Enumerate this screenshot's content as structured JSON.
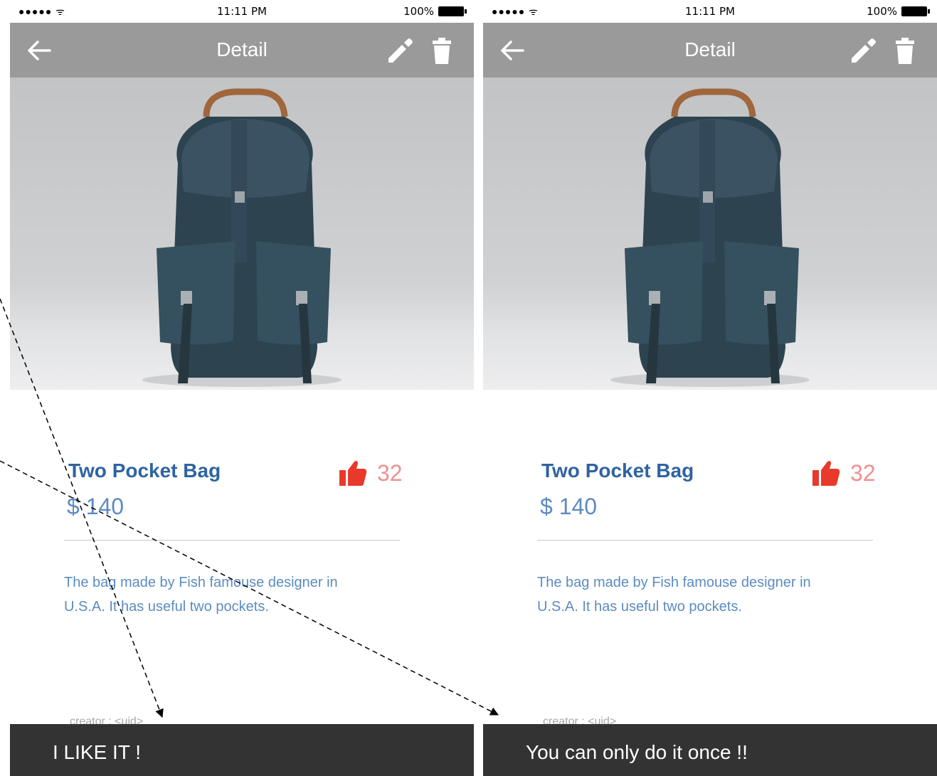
{
  "status_bar": {
    "signal": "●●●●● ",
    "time": "11:11 PM",
    "battery": "100%"
  },
  "app_bar": {
    "title": "Detail"
  },
  "icons": {
    "back": "arrow-left-icon",
    "edit": "pencil-icon",
    "delete": "trash-icon",
    "like": "thumbs-up-icon"
  },
  "product": {
    "title": "Two Pocket Bag",
    "price": "$ 140",
    "likes": "32",
    "description": "The bag made by Fish famouse designer in U.S.A. It has useful two pockets.",
    "creator": "creator : <uid>"
  },
  "screens": [
    {
      "snackbar": "I LIKE IT !"
    },
    {
      "snackbar": "You can only do it once !!"
    }
  ],
  "colors": {
    "app_bar": "#9a9a9a",
    "title": "#2f63a1",
    "price": "#5d8bc1",
    "like_icon": "#e8392a",
    "like_count": "#ee9090",
    "snackbar": "#333333"
  }
}
